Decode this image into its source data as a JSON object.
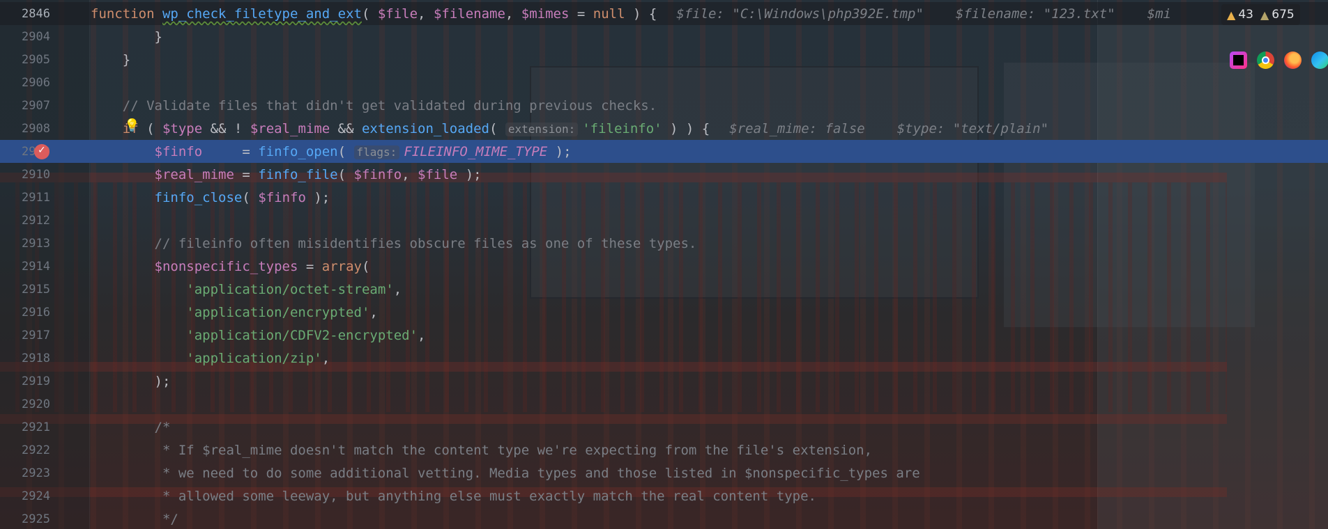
{
  "editor": {
    "inspections": {
      "warnings": "43",
      "weak_warnings": "675"
    },
    "browsers": [
      "phpstorm-icon",
      "chrome-icon",
      "firefox-icon",
      "edge-icon"
    ],
    "lines": [
      {
        "n": "2846",
        "tokens": [
          {
            "t": "function",
            "c": "kw"
          },
          {
            "t": " ",
            "c": "punc"
          },
          {
            "t": "wp_check_filetype_and_ext",
            "c": "fndef"
          },
          {
            "t": "( ",
            "c": "punc"
          },
          {
            "t": "$file",
            "c": "var"
          },
          {
            "t": ", ",
            "c": "punc"
          },
          {
            "t": "$filename",
            "c": "var"
          },
          {
            "t": ", ",
            "c": "punc"
          },
          {
            "t": "$mimes",
            "c": "var"
          },
          {
            "t": " = ",
            "c": "op"
          },
          {
            "t": "null",
            "c": "kw"
          },
          {
            "t": " ) {",
            "c": "punc"
          },
          {
            "t": "$file: \"C:\\Windows\\php392E.tmp\"",
            "c": "dbg"
          },
          {
            "t": "$filename: \"123.txt\"",
            "c": "dbg"
          },
          {
            "t": "$mi",
            "c": "dbg"
          }
        ]
      },
      {
        "n": "2904",
        "tokens": [
          {
            "t": "        }",
            "c": "punc"
          }
        ]
      },
      {
        "n": "2905",
        "tokens": [
          {
            "t": "    }",
            "c": "punc"
          }
        ]
      },
      {
        "n": "2906",
        "tokens": []
      },
      {
        "n": "2907",
        "tokens": [
          {
            "t": "    // Validate files that didn't get validated during previous checks.",
            "c": "cmt"
          }
        ]
      },
      {
        "n": "2908",
        "tokens": [
          {
            "t": "    if",
            "c": "kw"
          },
          {
            "t": " ( ",
            "c": "punc"
          },
          {
            "t": "$type",
            "c": "var"
          },
          {
            "t": " && ! ",
            "c": "op"
          },
          {
            "t": "$real_mime",
            "c": "var"
          },
          {
            "t": " && ",
            "c": "op"
          },
          {
            "t": "extension_loaded",
            "c": "fn"
          },
          {
            "t": "( ",
            "c": "punc"
          },
          {
            "t": "extension:",
            "c": "hint"
          },
          {
            "t": "'fileinfo'",
            "c": "str"
          },
          {
            "t": " ) ) {",
            "c": "punc"
          },
          {
            "t": "$real_mime: false",
            "c": "dbg"
          },
          {
            "t": "$type: \"text/plain\"",
            "c": "dbg"
          }
        ]
      },
      {
        "n": "2909",
        "tokens": [
          {
            "t": "        ",
            "c": "punc"
          },
          {
            "t": "$finfo",
            "c": "var"
          },
          {
            "t": "     = ",
            "c": "op"
          },
          {
            "t": "finfo_open",
            "c": "fn"
          },
          {
            "t": "( ",
            "c": "punc"
          },
          {
            "t": "flags:",
            "c": "hint"
          },
          {
            "t": "FILEINFO_MIME_TYPE",
            "c": "const"
          },
          {
            "t": " );",
            "c": "punc"
          }
        ]
      },
      {
        "n": "2910",
        "tokens": [
          {
            "t": "        ",
            "c": "punc"
          },
          {
            "t": "$real_mime",
            "c": "var"
          },
          {
            "t": " = ",
            "c": "op"
          },
          {
            "t": "finfo_file",
            "c": "fn"
          },
          {
            "t": "( ",
            "c": "punc"
          },
          {
            "t": "$finfo",
            "c": "var"
          },
          {
            "t": ", ",
            "c": "punc"
          },
          {
            "t": "$file",
            "c": "var"
          },
          {
            "t": " );",
            "c": "punc"
          }
        ]
      },
      {
        "n": "2911",
        "tokens": [
          {
            "t": "        ",
            "c": "punc"
          },
          {
            "t": "finfo_close",
            "c": "fn"
          },
          {
            "t": "( ",
            "c": "punc"
          },
          {
            "t": "$finfo",
            "c": "var"
          },
          {
            "t": " );",
            "c": "punc"
          }
        ]
      },
      {
        "n": "2912",
        "tokens": []
      },
      {
        "n": "2913",
        "tokens": [
          {
            "t": "        // fileinfo often misidentifies obscure files as one of these types.",
            "c": "cmt"
          }
        ]
      },
      {
        "n": "2914",
        "tokens": [
          {
            "t": "        ",
            "c": "punc"
          },
          {
            "t": "$nonspecific_types",
            "c": "var"
          },
          {
            "t": " = ",
            "c": "op"
          },
          {
            "t": "array",
            "c": "kw"
          },
          {
            "t": "(",
            "c": "punc"
          }
        ]
      },
      {
        "n": "2915",
        "tokens": [
          {
            "t": "            ",
            "c": "punc"
          },
          {
            "t": "'application/octet-stream'",
            "c": "str"
          },
          {
            "t": ",",
            "c": "punc"
          }
        ]
      },
      {
        "n": "2916",
        "tokens": [
          {
            "t": "            ",
            "c": "punc"
          },
          {
            "t": "'application/encrypted'",
            "c": "str"
          },
          {
            "t": ",",
            "c": "punc"
          }
        ]
      },
      {
        "n": "2917",
        "tokens": [
          {
            "t": "            ",
            "c": "punc"
          },
          {
            "t": "'application/CDFV2-encrypted'",
            "c": "str"
          },
          {
            "t": ",",
            "c": "punc"
          }
        ]
      },
      {
        "n": "2918",
        "tokens": [
          {
            "t": "            ",
            "c": "punc"
          },
          {
            "t": "'application/zip'",
            "c": "str"
          },
          {
            "t": ",",
            "c": "punc"
          }
        ]
      },
      {
        "n": "2919",
        "tokens": [
          {
            "t": "        );",
            "c": "punc"
          }
        ]
      },
      {
        "n": "2920",
        "tokens": []
      },
      {
        "n": "2921",
        "tokens": [
          {
            "t": "        /*",
            "c": "cmt"
          }
        ]
      },
      {
        "n": "2922",
        "tokens": [
          {
            "t": "         * If $real_mime doesn't match the content type we're expecting from the file's extension,",
            "c": "cmt"
          }
        ]
      },
      {
        "n": "2923",
        "tokens": [
          {
            "t": "         * we need to do some additional vetting. Media types and those listed in $nonspecific_types are",
            "c": "cmt"
          }
        ]
      },
      {
        "n": "2924",
        "tokens": [
          {
            "t": "         * allowed some leeway, but anything else must exactly match the real content type.",
            "c": "cmt"
          }
        ]
      },
      {
        "n": "2925",
        "tokens": [
          {
            "t": "         */",
            "c": "cmt"
          }
        ]
      }
    ]
  }
}
